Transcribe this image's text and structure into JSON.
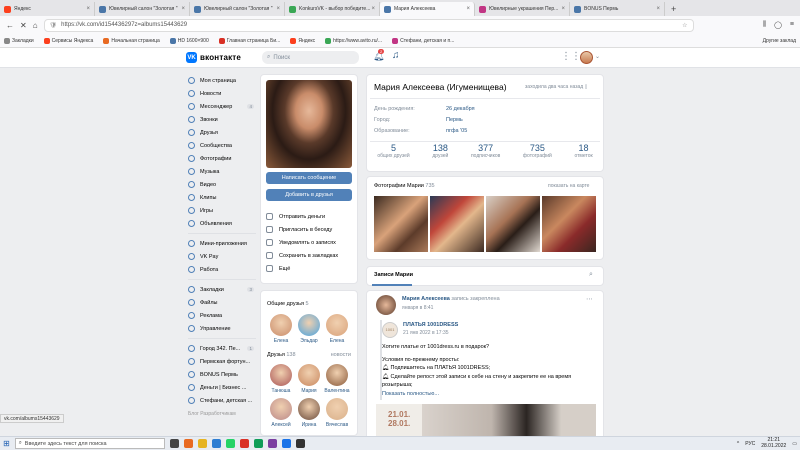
{
  "browser": {
    "tabs": [
      {
        "label": "Яндекс",
        "color": "#fc3f1d"
      },
      {
        "label": "Ювелирный салон \"Золотая \"",
        "color": "#4a76a8"
      },
      {
        "label": "Ювелирный салон \"Золотая \"",
        "color": "#4a76a8"
      },
      {
        "label": "KonkursVK - выбор победите...",
        "color": "#3aa755"
      },
      {
        "label": "Мария Алексеева",
        "color": "#4a76a8"
      },
      {
        "label": "Ювелирные украшения Пер...",
        "color": "#c13584"
      },
      {
        "label": "BONUS Пермь",
        "color": "#4a76a8"
      }
    ],
    "new_tab": "+",
    "url": "https://vk.com/id154436297z=albums15443629",
    "bookmarks": [
      "Закладки",
      "Сервисы Яндекса",
      "Начальная страница",
      "HD 1600×900",
      "Главная страница Би...",
      "Яндекс",
      "https://www.avito.ru/...",
      "Стефани, детская и п..."
    ],
    "other_bookmarks": "Другие заклад"
  },
  "vk": {
    "logo": "вконтакте",
    "search_placeholder": "Поиск",
    "notif_count": "2",
    "menu": [
      {
        "label": "Моя страница",
        "icon": "home-icon"
      },
      {
        "label": "Новости",
        "icon": "news-icon"
      },
      {
        "label": "Мессенджер",
        "icon": "message-icon",
        "count": "4"
      },
      {
        "label": "Звонки",
        "icon": "phone-icon"
      },
      {
        "label": "Друзья",
        "icon": "friends-icon"
      },
      {
        "label": "Сообщества",
        "icon": "community-icon"
      },
      {
        "label": "Фотографии",
        "icon": "photo-icon"
      },
      {
        "label": "Музыка",
        "icon": "music-icon"
      },
      {
        "label": "Видео",
        "icon": "video-icon"
      },
      {
        "label": "Клипы",
        "icon": "clips-icon"
      },
      {
        "label": "Игры",
        "icon": "games-icon"
      },
      {
        "label": "Объявления",
        "icon": "ads-icon"
      }
    ],
    "menu2": [
      {
        "label": "Мини-приложения",
        "icon": "apps-icon"
      },
      {
        "label": "VK Pay",
        "icon": "pay-icon"
      },
      {
        "label": "Работа",
        "icon": "work-icon"
      }
    ],
    "menu3": [
      {
        "label": "Закладки",
        "icon": "bookmark-icon",
        "count": "3"
      },
      {
        "label": "Файлы",
        "icon": "file-icon"
      },
      {
        "label": "Реклама",
        "icon": "megaphone-icon"
      },
      {
        "label": "Управление",
        "icon": "manage-icon"
      }
    ],
    "menu4": [
      {
        "label": "Город 342. Пе...",
        "icon": "group-icon",
        "count": "1"
      },
      {
        "label": "Пермская фортун...",
        "icon": "group-icon"
      },
      {
        "label": "BONUS Пермь",
        "icon": "group-icon"
      },
      {
        "label": "Деньги | Бизнес ...",
        "icon": "group-icon"
      },
      {
        "label": "Стефани, детская ...",
        "icon": "group-icon"
      }
    ],
    "menu_footer": "Блог   Разработчикам"
  },
  "profile": {
    "name": "Мария Алексеева (Игуменищева)",
    "online": "заходила два часа назад",
    "write_btn": "Написать сообщение",
    "add_btn": "Добавить в друзья",
    "actions": [
      "Отправить деньги",
      "Пригласить в беседу",
      "Уведомлять о записях",
      "Сохранить в закладках",
      "Ещё"
    ],
    "info": [
      {
        "k": "День рождения:",
        "v": "26 декабря"
      },
      {
        "k": "Город:",
        "v": "Пермь"
      },
      {
        "k": "Образование:",
        "v": "пгфа '05"
      }
    ],
    "counts": [
      {
        "n": "5",
        "l": "общих друзей"
      },
      {
        "n": "138",
        "l": "друзей"
      },
      {
        "n": "377",
        "l": "подписчиков"
      },
      {
        "n": "735",
        "l": "фотографий"
      },
      {
        "n": "18",
        "l": "отметок"
      }
    ],
    "common_friends": {
      "title": "Общие друзья",
      "count": "5",
      "names": [
        "Елена",
        "Эльдар",
        "Елена"
      ]
    },
    "friends": {
      "title": "Друзья",
      "count": "138",
      "more": "новости",
      "names": [
        "Танюша",
        "Мария",
        "Валентина",
        "Алексей",
        "Ирина",
        "Вячеслав"
      ]
    }
  },
  "photos": {
    "title": "Фотографии Марии",
    "count": "735",
    "map": "показать на карте"
  },
  "wall": {
    "tab": "Записи Марии",
    "author": "Мария Алексеева",
    "pinned": "запись закреплена",
    "date": "января в 8:41",
    "repost_author": "ПЛАТЬЯ 1001DRESS",
    "repost_date": "21 янв 2022 в 17:35",
    "line1": "Хотите платье от 1001dress.ru в подарок?",
    "line2": "Условия по-прежнему просты:",
    "line3": "Подпишитесь на ПЛАТЬЯ 1001DRESS;",
    "line4": "Сделайте репост этой записи к себе на стену и закрепите ее на время розыгрыша;",
    "more": "Показать полностью...",
    "banner_dates": "21.01.\n28.01."
  },
  "status_url": "vk.com/albums15443629",
  "taskbar": {
    "search": "Введите здесь текст для поиска",
    "lang": "РУС",
    "time": "21:21",
    "date": "28.01.2022"
  }
}
